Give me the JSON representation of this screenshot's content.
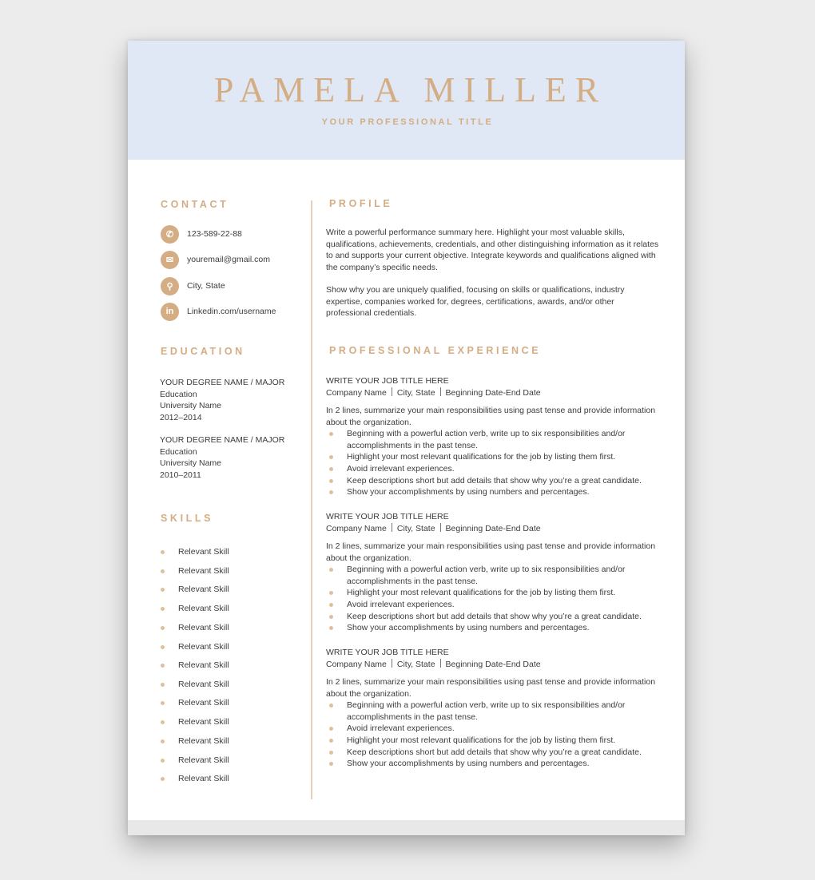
{
  "header": {
    "name": "PAMELA MILLER",
    "professional_title": "YOUR PROFESSIONAL TITLE"
  },
  "colors": {
    "accent": "#d4ad84",
    "header_bg": "#dfe8f4",
    "text": "#3c3c3c"
  },
  "contact": {
    "title": "CONTACT",
    "items": [
      {
        "icon": "phone-icon",
        "glyph": "✆",
        "text": "123-589-22-88"
      },
      {
        "icon": "email-icon",
        "glyph": "✉",
        "text": "youremail@gmail.com"
      },
      {
        "icon": "location-pin-icon",
        "glyph": "⚲",
        "text": "City, State"
      },
      {
        "icon": "linkedin-icon",
        "glyph": "in",
        "text": "Linkedin.com/username"
      }
    ]
  },
  "education": {
    "title": "EDUCATION",
    "entries": [
      {
        "degree": "YOUR DEGREE NAME / MAJOR",
        "field": "Education",
        "school": "University Name",
        "years": "2012–2014"
      },
      {
        "degree": "YOUR DEGREE NAME / MAJOR",
        "field": "Education",
        "school": "University Name",
        "years": "2010–2011"
      }
    ]
  },
  "skills": {
    "title": "SKILLS",
    "items": [
      "Relevant Skill",
      "Relevant Skill",
      "Relevant Skill",
      "Relevant Skill",
      "Relevant Skill",
      "Relevant Skill",
      "Relevant Skill",
      "Relevant Skill",
      "Relevant Skill",
      "Relevant Skill",
      "Relevant Skill",
      "Relevant Skill",
      "Relevant Skill"
    ]
  },
  "profile": {
    "title": "PROFILE",
    "paragraphs": [
      "Write a powerful performance summary here. Highlight your most valuable skills, qualifications, achievements, credentials, and other distinguishing information as it relates to and supports your current objective. Integrate keywords and qualifications aligned with the company’s specific needs.",
      "Show why you are uniquely qualified, focusing on skills or qualifications, industry expertise, companies worked for, degrees, certifications, awards, and/or other professional credentials."
    ]
  },
  "experience": {
    "title": "PROFESSIONAL EXPERIENCE",
    "jobs": [
      {
        "job_title": "WRITE YOUR JOB TITLE HERE",
        "company": "Company Name",
        "location": "City, State",
        "dates": "Beginning Date-End Date",
        "summary": "In 2 lines, summarize your main responsibilities using past tense and provide information about the organization.",
        "bullets": [
          "Beginning with a powerful action verb, write up to six responsibilities and/or accomplishments in the past tense.",
          "Highlight your most relevant qualifications for the job by listing them first.",
          "Avoid irrelevant experiences.",
          "Keep descriptions short but add details that show why you’re a great candidate.",
          "Show your accomplishments by using numbers and percentages."
        ]
      },
      {
        "job_title": "WRITE YOUR JOB TITLE HERE",
        "company": "Company Name",
        "location": "City, State",
        "dates": "Beginning Date-End Date",
        "summary": "In 2 lines, summarize your main responsibilities using past tense and provide information about the organization.",
        "bullets": [
          "Beginning with a powerful action verb, write up to six responsibilities and/or accomplishments in the past tense.",
          "Highlight your most relevant qualifications for the job by listing them first.",
          "Avoid irrelevant experiences.",
          "Keep descriptions short but add details that show why you’re a great candidate.",
          "Show your accomplishments by using numbers and percentages."
        ]
      },
      {
        "job_title": "WRITE YOUR JOB TITLE HERE",
        "company": "Company Name",
        "location": "City, State",
        "dates": "Beginning Date-End Date",
        "summary": "In 2 lines, summarize your main responsibilities using past tense and provide information about the organization.",
        "bullets": [
          "Beginning with a powerful action verb, write up to six responsibilities and/or accomplishments in the past tense.",
          "Avoid irrelevant experiences.",
          "Highlight your most relevant qualifications for the job by listing them first.",
          "Keep descriptions short but add details that show why you’re a great candidate.",
          "Show your accomplishments by using numbers and percentages."
        ]
      }
    ]
  }
}
